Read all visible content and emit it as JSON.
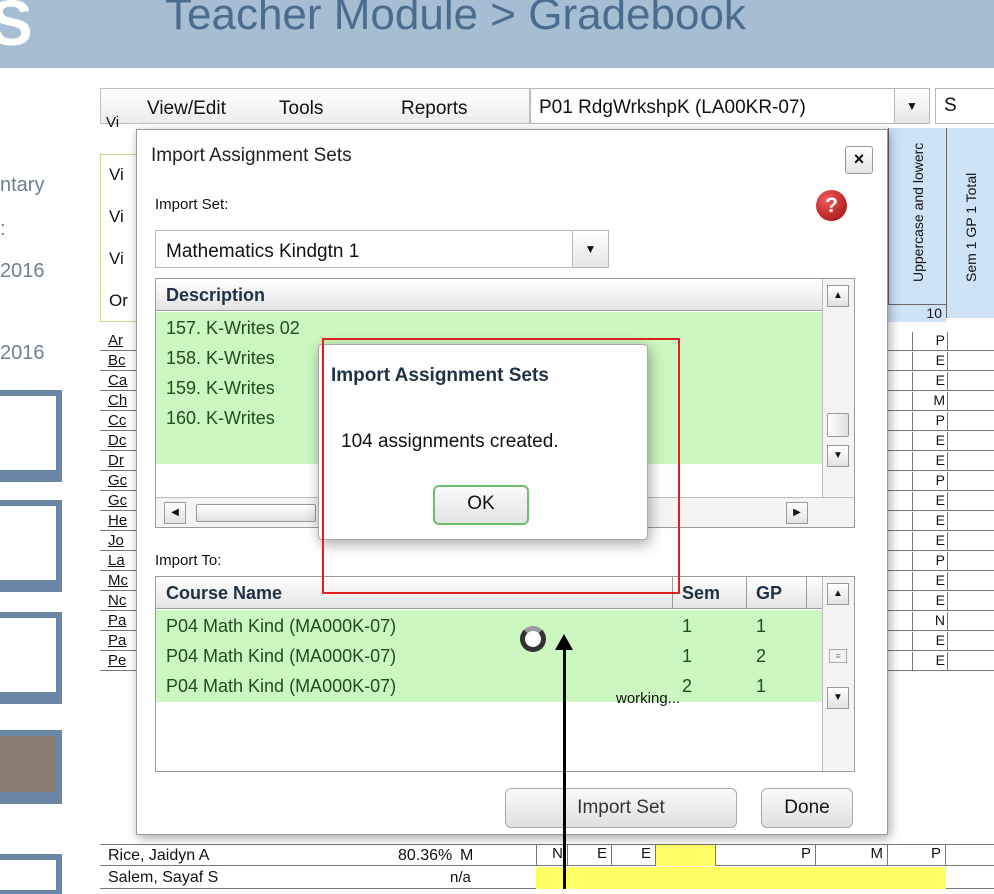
{
  "header": {
    "title": "Teacher Module > Gradebook"
  },
  "left_panel": {
    "lines": [
      "ntary",
      ":",
      "2016",
      "2016"
    ]
  },
  "menu": {
    "items": [
      "View/Edit",
      "Tools",
      "Reports"
    ]
  },
  "class_select": {
    "value": "P01   RdgWrkshpK (LA00KR-07)",
    "extra": "S"
  },
  "grid": {
    "column_headers": [
      "Uppercase and lowerc",
      "Sem 1 GP 1 Total"
    ],
    "points_possible": "10",
    "behind_labels": [
      "Vi",
      "Vi",
      "Vi",
      "Vi",
      "Or"
    ],
    "students": [
      "Ar",
      "Bc",
      "Ca",
      "Ch",
      "Cc",
      "Dc",
      "Dr",
      "Gc",
      "Gc",
      "He",
      "Jo",
      "La",
      "Mc",
      "Nc",
      "Pa",
      "Pa",
      "Pe"
    ],
    "student_scores": [
      "P",
      "E",
      "E",
      "M",
      "P",
      "E",
      "E",
      "P",
      "E",
      "E",
      "E",
      "P",
      "E",
      "E",
      "N",
      "E",
      "E"
    ],
    "rice_row": {
      "name": "Rice, Jaidyn A",
      "avg": "80.36%",
      "grade": "M",
      "marks": [
        "N",
        "E",
        "E",
        "P",
        "M",
        "P"
      ]
    },
    "salem_row": {
      "name": "Salem, Sayaf S",
      "avg": "n/a"
    }
  },
  "import_dialog": {
    "title": "Import Assignment Sets",
    "close_label": "×",
    "help_label": "?",
    "import_set_label": "Import Set:",
    "import_set_value": "Mathematics Kindgtn 1",
    "description_header": "Description",
    "descriptions": [
      "157. K-Writes 02",
      "158. K-Writes",
      "159. K-Writes",
      "160. K-Writes"
    ],
    "import_to_label": "Import To:",
    "course_headers": {
      "name": "Course Name",
      "sem": "Sem",
      "gp": "GP"
    },
    "courses": [
      {
        "name": "P04   Math Kind (MA000K-07)",
        "sem": "1",
        "gp": "1"
      },
      {
        "name": "P04   Math Kind (MA000K-07)",
        "sem": "1",
        "gp": "2"
      },
      {
        "name": "P04   Math Kind (MA000K-07)",
        "sem": "2",
        "gp": "1"
      }
    ],
    "import_set_button": "Import Set",
    "done_button": "Done",
    "working_text": "working..."
  },
  "alert": {
    "title": "Import Assignment Sets",
    "message": "104 assignments created.",
    "ok_label": "OK"
  },
  "colors": {
    "header_bg": "#a7bdd2",
    "row_green": "#ccf7c0",
    "highlight_red": "#e02020",
    "grade_yellow": "#ffff66"
  }
}
